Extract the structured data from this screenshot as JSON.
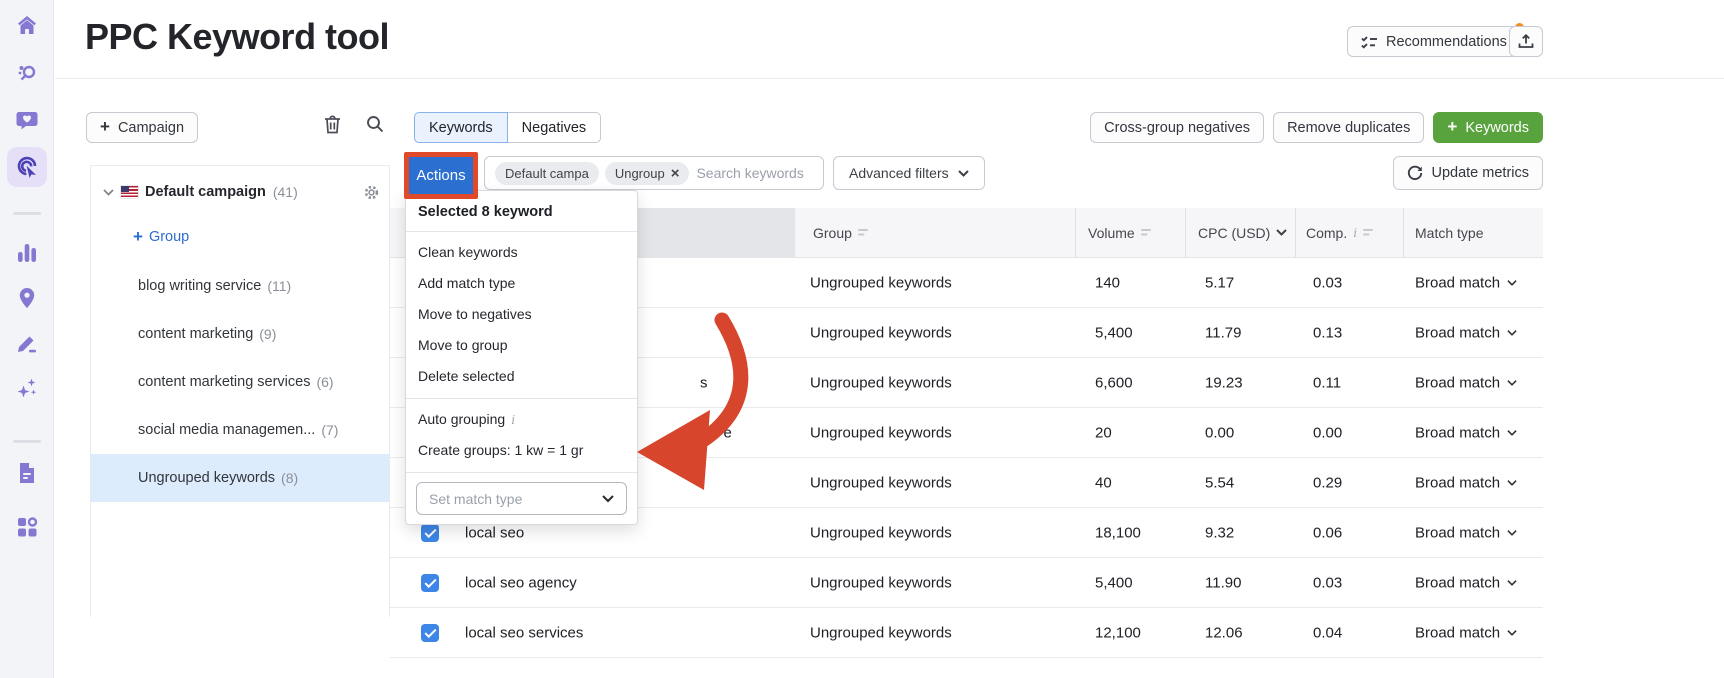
{
  "page": {
    "title": "PPC Keyword tool"
  },
  "header": {
    "recommendations": "Recommendations",
    "export_icon": "export-icon",
    "notification_dot": true
  },
  "toolbar": {
    "campaign": "Campaign",
    "tabs": [
      {
        "label": "Keywords",
        "active": true
      },
      {
        "label": "Negatives",
        "active": false
      }
    ],
    "cross_group_negatives": "Cross-group negatives",
    "remove_duplicates": "Remove duplicates",
    "add_keywords": "Keywords",
    "update_metrics": "Update metrics"
  },
  "sidebar_icons": [
    "home-icon",
    "keyword-research-icon",
    "feedback-icon",
    "ppc-keyword-tool-icon",
    "analytics-icon",
    "location-icon",
    "compose-icon",
    "ai-sparkles-icon",
    "notes-icon",
    "apps-icon"
  ],
  "tree": {
    "campaign": {
      "name": "Default campaign",
      "count": "(41)"
    },
    "add_group_label": "Group",
    "groups": [
      {
        "name": "blog writing service",
        "count": "(11)",
        "selected": false
      },
      {
        "name": "content marketing",
        "count": "(9)",
        "selected": false
      },
      {
        "name": "content marketing services",
        "count": "(6)",
        "selected": false
      },
      {
        "name": "social media managemen...",
        "count": "(7)",
        "selected": false
      },
      {
        "name": "Ungrouped keywords",
        "count": "(8)",
        "selected": true
      }
    ]
  },
  "filter_bar": {
    "actions": "Actions",
    "chips": [
      {
        "label": "Default campa",
        "removable": false
      },
      {
        "label": "Ungroup",
        "removable": true
      }
    ],
    "search_placeholder": "Search keywords",
    "advanced_filters": "Advanced filters"
  },
  "actions_menu": {
    "title": "Selected 8 keyword",
    "items": [
      "Clean keywords",
      "Add match type",
      "Move to negatives",
      "Move to group",
      "Delete selected"
    ],
    "grouping_items": [
      {
        "label": "Auto grouping",
        "has_info": true
      },
      {
        "label": "Create groups: 1 kw = 1 gr",
        "has_info": false
      }
    ],
    "match_select_placeholder": "Set match type"
  },
  "table": {
    "columns": [
      {
        "label": "Group"
      },
      {
        "label": "Volume"
      },
      {
        "label": "CPC (USD)"
      },
      {
        "label": "Comp."
      },
      {
        "label": "Match type"
      }
    ],
    "rows": [
      {
        "keyword_visible": "",
        "group": "Ungrouped keywords",
        "volume": "140",
        "cpc": "5.17",
        "comp": "0.03",
        "match_type": "Broad match",
        "checked": true
      },
      {
        "keyword_visible": "",
        "group": "Ungrouped keywords",
        "volume": "5,400",
        "cpc": "11.79",
        "comp": "0.13",
        "match_type": "Broad match",
        "checked": true
      },
      {
        "keyword_visible": "s",
        "group": "Ungrouped keywords",
        "volume": "6,600",
        "cpc": "19.23",
        "comp": "0.11",
        "match_type": "Broad match",
        "checked": true
      },
      {
        "keyword_visible": "n e",
        "group": "Ungrouped keywords",
        "volume": "20",
        "cpc": "0.00",
        "comp": "0.00",
        "match_type": "Broad match",
        "checked": true
      },
      {
        "keyword_visible": "",
        "group": "Ungrouped keywords",
        "volume": "40",
        "cpc": "5.54",
        "comp": "0.29",
        "match_type": "Broad match",
        "checked": true
      },
      {
        "keyword_visible": "local seo",
        "group": "Ungrouped keywords",
        "volume": "18,100",
        "cpc": "9.32",
        "comp": "0.06",
        "match_type": "Broad match",
        "checked": true
      },
      {
        "keyword_visible": "local seo agency",
        "group": "Ungrouped keywords",
        "volume": "5,400",
        "cpc": "11.90",
        "comp": "0.03",
        "match_type": "Broad match",
        "checked": true
      },
      {
        "keyword_visible": "local seo services",
        "group": "Ungrouped keywords",
        "volume": "12,100",
        "cpc": "12.06",
        "comp": "0.04",
        "match_type": "Broad match",
        "checked": true
      }
    ]
  },
  "colors": {
    "accent_blue": "#2b6fd1",
    "primary_green": "#58a33e",
    "annotation_red": "#e0492a",
    "notification_orange": "#f28b20",
    "selected_row_blue": "#dcecfc",
    "sidebar_purple": "#8478d2"
  }
}
